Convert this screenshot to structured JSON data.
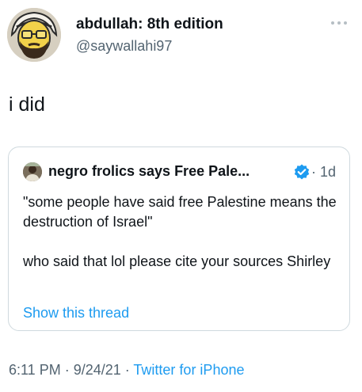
{
  "author": {
    "display_name": "abdullah: 8th edition",
    "handle": "@saywallahi97",
    "avatar_icon": "cartoon-avatar-icon"
  },
  "tweet": {
    "text": "i did"
  },
  "more_icon": "ellipsis-icon",
  "quoted_tweet": {
    "display_name": "negro frolics says Free Pale...",
    "verified_icon": "verified-badge-icon",
    "time": "· 1d",
    "paragraphs": [
      "\"some people have said free Palestine means the destruction of Israel\"",
      "who said that lol please cite your sources Shirley"
    ],
    "show_thread": "Show this thread"
  },
  "meta": {
    "timestamp": "6:11 PM · 9/24/21 · ",
    "source": "Twitter for iPhone"
  },
  "colors": {
    "link": "#1d9bf0",
    "secondary_text": "#536471",
    "border": "#cfd9de"
  }
}
